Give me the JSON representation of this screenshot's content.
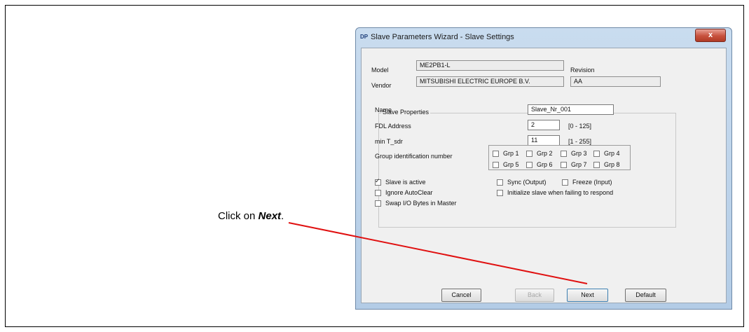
{
  "callout": {
    "prefix": "Click on ",
    "strong": "Next",
    "suffix": "."
  },
  "window": {
    "icon_text": "DP",
    "title": "Slave Parameters Wizard - Slave Settings",
    "close_label": "x"
  },
  "info": {
    "model_label": "Model",
    "model_value": "ME2PB1-L",
    "revision_label": "Revision",
    "revision_value": "",
    "vendor_label": "Vendor",
    "vendor_value": "MITSUBISHI ELECTRIC EUROPE B.V.",
    "vendor_code": "AA"
  },
  "slave_properties": {
    "legend": "Slave Properties",
    "name_label": "Name",
    "name_value": "Slave_Nr_001",
    "fdl_label": "FDL Address",
    "fdl_value": "2",
    "fdl_range": "[0 - 125]",
    "tsdr_label": "min T_sdr",
    "tsdr_value": "11",
    "tsdr_range": "[1 - 255]",
    "group_label": "Group identification number",
    "groups": [
      "Grp 1",
      "Grp 2",
      "Grp 3",
      "Grp 4",
      "Grp 5",
      "Grp 6",
      "Grp 7",
      "Grp 8"
    ],
    "options": {
      "slave_active": {
        "label": "Slave is active",
        "checked": true
      },
      "ignore_autoclear": {
        "label": "Ignore AutoClear",
        "checked": false
      },
      "swap_io": {
        "label": "Swap I/O Bytes in Master",
        "checked": false
      },
      "sync_output": {
        "label": "Sync (Output)",
        "checked": false
      },
      "freeze_input": {
        "label": "Freeze (Input)",
        "checked": false
      },
      "init_slave": {
        "label": "Initialize slave when failing to respond",
        "checked": false
      }
    }
  },
  "buttons": {
    "cancel": "Cancel",
    "back": "Back",
    "next": "Next",
    "default": "Default"
  }
}
